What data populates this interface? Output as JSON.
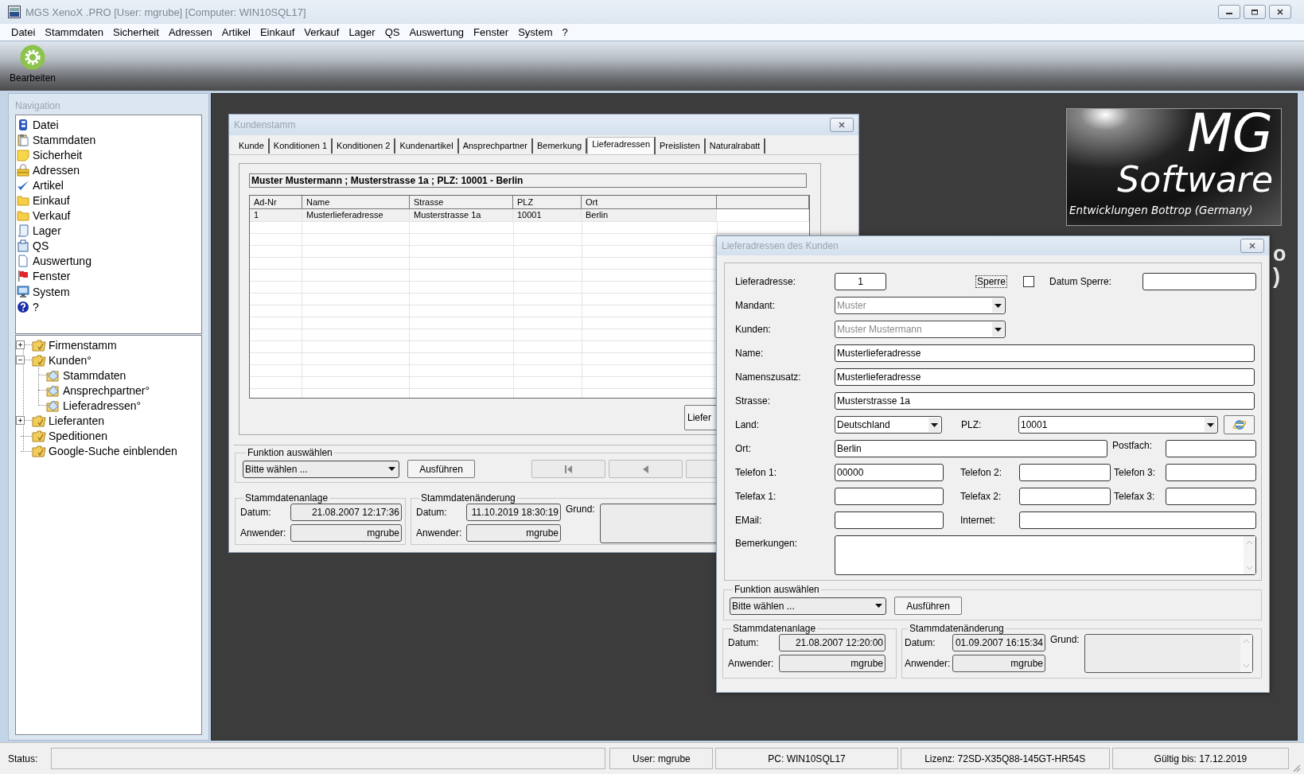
{
  "window": {
    "title": "MGS XenoX .PRO [User: mgrube] [Computer: WIN10SQL17]"
  },
  "menu": [
    "Datei",
    "Stammdaten",
    "Sicherheit",
    "Adressen",
    "Artikel",
    "Einkauf",
    "Verkauf",
    "Lager",
    "QS",
    "Auswertung",
    "Fenster",
    "System",
    "?"
  ],
  "toolbar": [
    {
      "label": "Bearbeiten"
    }
  ],
  "navigation": {
    "title": "Navigation",
    "items": [
      "Datei",
      "Stammdaten",
      "Sicherheit",
      "Adressen",
      "Artikel",
      "Einkauf",
      "Verkauf",
      "Lager",
      "QS",
      "Auswertung",
      "Fenster",
      "System",
      "?"
    ],
    "tree": [
      {
        "label": "Firmenstamm",
        "expanded": false
      },
      {
        "label": "Kunden°",
        "expanded": true,
        "children": [
          {
            "label": "Stammdaten"
          },
          {
            "label": "Ansprechpartner°"
          },
          {
            "label": "Lieferadressen°"
          }
        ]
      },
      {
        "label": "Lieferanten",
        "expanded": false
      },
      {
        "label": "Speditionen"
      },
      {
        "label": "Google-Suche einblenden"
      }
    ]
  },
  "desktop": {
    "logo": {
      "title": "MG",
      "subtitle": "Software",
      "tagline": "Entwicklungen Bottrop (Germany)"
    },
    "text_fragments": [
      "o",
      ")"
    ]
  },
  "customer_window": {
    "title": "Kundenstamm",
    "tabs": [
      {
        "label": "Kunde",
        "selected": false
      },
      {
        "label": "Konditionen 1",
        "selected": false
      },
      {
        "label": "Konditionen 2",
        "selected": false
      },
      {
        "label": "Kundenartikel",
        "selected": false
      },
      {
        "label": "Ansprechpartner",
        "selected": false
      },
      {
        "label": "Bemerkung",
        "selected": false
      },
      {
        "label": "Lieferadressen",
        "selected": true
      },
      {
        "label": "Preislisten",
        "selected": false
      },
      {
        "label": "Naturalrabatt",
        "selected": false
      }
    ],
    "summary": "Muster Mustermann ; Musterstrasse 1a ; PLZ: 10001 - Berlin",
    "table": {
      "columns": [
        "Ad-Nr",
        "Name",
        "Strasse",
        "PLZ",
        "Ort"
      ],
      "rows": [
        [
          "1",
          "Musterlieferadresse",
          "Musterstrasse 1a",
          "10001",
          "Berlin"
        ]
      ]
    },
    "side_button": "Liefer",
    "function_group": {
      "legend": "Funktion auswählen",
      "select": "Bitte wählen ...",
      "button": "Ausführen"
    },
    "created": {
      "legend": "Stammdatenanlage",
      "date_label": "Datum:",
      "date": "21.08.2007 12:17:36",
      "user_label": "Anwender:",
      "user": "mgrube"
    },
    "changed": {
      "legend": "Stammdatenänderung",
      "date_label": "Datum:",
      "date": "11.10.2019 18:30:19",
      "user_label": "Anwender:",
      "user": "mgrube",
      "reason_label": "Grund:"
    }
  },
  "dialog": {
    "title": "Lieferadressen des Kunden",
    "form": {
      "delivery_address": {
        "label": "Lieferadresse:",
        "value": "1"
      },
      "lock": {
        "label": "Sperre",
        "checked": false,
        "focused": true
      },
      "lock_date": {
        "label": "Datum Sperre:"
      },
      "client": {
        "label": "Mandant:",
        "value": "Muster",
        "disabled": true
      },
      "customer": {
        "label": "Kunden:",
        "value": "Muster Mustermann",
        "disabled": true
      },
      "name": {
        "label": "Name:",
        "value": "Musterlieferadresse"
      },
      "name_suffix": {
        "label": "Namenszusatz:",
        "value": "Musterlieferadresse"
      },
      "street": {
        "label": "Strasse:",
        "value": "Musterstrasse 1a"
      },
      "country": {
        "label": "Land:",
        "value": "Deutschland"
      },
      "zip": {
        "label": "PLZ:",
        "value": "10001"
      },
      "city": {
        "label": "Ort:",
        "value": "Berlin"
      },
      "po_box": {
        "label": "Postfach:"
      },
      "phone_1": {
        "label": "Telefon 1:",
        "value": "00000"
      },
      "phone_2": {
        "label": "Telefon 2:"
      },
      "phone_3": {
        "label": "Telefon 3:"
      },
      "fax_1": {
        "label": "Telefax 1:"
      },
      "fax_2": {
        "label": "Telefax 2:"
      },
      "fax_3": {
        "label": "Telefax 3:"
      },
      "email": {
        "label": "EMail:"
      },
      "internet": {
        "label": "Internet:"
      },
      "remarks": {
        "label": "Bemerkungen:"
      }
    },
    "function_group": {
      "legend": "Funktion auswählen",
      "select": "Bitte wählen ...",
      "button": "Ausführen"
    },
    "created": {
      "legend": "Stammdatenanlage",
      "date_label": "Datum:",
      "date": "21.08.2007 12:20:00",
      "user_label": "Anwender:",
      "user": "mgrube"
    },
    "changed": {
      "legend": "Stammdatenänderung",
      "date_label": "Datum:",
      "date": "01.09.2007 16:15:34",
      "user_label": "Anwender:",
      "user": "mgrube",
      "reason_label": "Grund:"
    }
  },
  "status_bar": {
    "label": "Status:",
    "panels": [
      "User: mgrube",
      "PC: WIN10SQL17",
      "Lizenz: 72SD-X35Q88-145GT-HR54S",
      "Gültig bis: 17.12.2019"
    ]
  }
}
